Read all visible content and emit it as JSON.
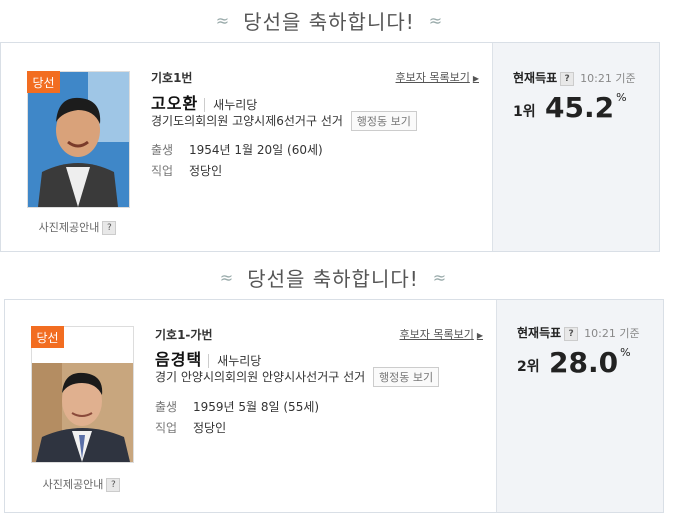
{
  "cards": [
    {
      "banner": "당선을 축하합니다!",
      "badge": "당선",
      "photo_notice": "사진제공안내",
      "cand_no": "기호1번",
      "cand_list": "후보자 목록보기",
      "name": "고오환",
      "party": "새누리당",
      "district": "경기도의회의원 고양시제6선거구 선거",
      "btn_area": "행정동 보기",
      "birth_label": "출생",
      "birth": "1954년 1월 20일 (60세)",
      "job_label": "직업",
      "job": "정당인",
      "current_title": "현재득표",
      "time": "10:21 기준",
      "rank": "1위",
      "percent": "45.2",
      "percent_sign": "%"
    },
    {
      "banner": "당선을 축하합니다!",
      "badge": "당선",
      "photo_notice": "사진제공안내",
      "cand_no": "기호1-가번",
      "cand_list": "후보자 목록보기",
      "name": "음경택",
      "party": "새누리당",
      "district": "경기 안양시의회의원 안양시사선거구 선거",
      "btn_area": "행정동 보기",
      "birth_label": "출생",
      "birth": "1959년 5월 8일 (55세)",
      "job_label": "직업",
      "job": "정당인",
      "current_title": "현재득표",
      "time": "10:21 기준",
      "rank": "2위",
      "percent": "28.0",
      "percent_sign": "%"
    }
  ],
  "question_mark": "?",
  "wave": "≈"
}
